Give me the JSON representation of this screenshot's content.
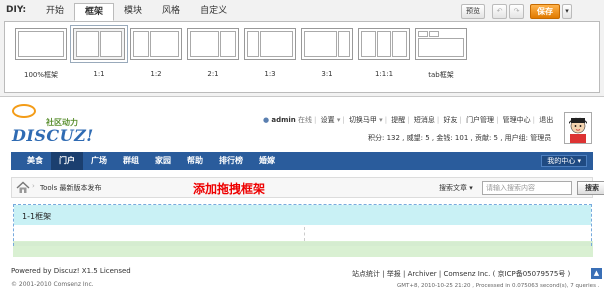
{
  "diy": {
    "label": "DIY:",
    "tabs": [
      "开始",
      "框架",
      "模块",
      "风格",
      "自定义"
    ],
    "active_tab": "框架",
    "buttons": {
      "preview": "预览",
      "undo": "↶",
      "redo": "↷",
      "save": "保存",
      "more": "▾"
    },
    "layouts": [
      {
        "label": "100%框架",
        "cols": [
          1
        ]
      },
      {
        "label": "1:1",
        "cols": [
          1,
          1
        ]
      },
      {
        "label": "1:2",
        "cols": [
          1,
          2
        ]
      },
      {
        "label": "2:1",
        "cols": [
          2,
          1
        ]
      },
      {
        "label": "1:3",
        "cols": [
          1,
          3
        ]
      },
      {
        "label": "3:1",
        "cols": [
          3,
          1
        ]
      },
      {
        "label": "1:1:1",
        "cols": [
          1,
          1,
          1
        ]
      },
      {
        "label": "tab框架",
        "cols": [
          1
        ]
      }
    ],
    "selected_layout": "1:1"
  },
  "header": {
    "logo_tagline": "社区动力",
    "logo_text": "DISCUZ!",
    "user": "admin",
    "status": "在线",
    "menu": [
      "设置",
      "切换马甲",
      "提醒",
      "短消息",
      "好友",
      "门户管理",
      "管理中心",
      "退出"
    ],
    "stats": "积分: 132 , 威望: 5 , 金钱: 101 , 贡献: 5 , 用户组: 管理员"
  },
  "nav": {
    "items": [
      "美食",
      "门户",
      "广场",
      "群组",
      "家园",
      "帮助",
      "排行榜",
      "婚嫁"
    ],
    "active": "门户",
    "my_center": "我的中心 ▾"
  },
  "breadcrumb": {
    "text": "Tools  最新版本发布",
    "add_frame_hint": "添加拖拽框架",
    "search_type": "搜索文章 ▾",
    "search_placeholder": "请输入搜索内容",
    "search_button": "搜索"
  },
  "frame": {
    "title": "1-1框架"
  },
  "footer": {
    "powered": "Powered by Discuz! X1.5 Licensed",
    "copyright": "© 2001-2010 Comsenz Inc.",
    "links": "站点统计 | 举报 | Archiver | Comsenz Inc. ( 京ICP备05079575号 )",
    "gmt": "GMT+8, 2010-10-25 21:20 , Processed in 0.075063 second(s), 7 queries ."
  },
  "colors": {
    "nav": "#2a5c9c",
    "accent_save": "#f08c10",
    "frame_header": "#c9f1f5",
    "add_frame_text": "#ee0000"
  }
}
